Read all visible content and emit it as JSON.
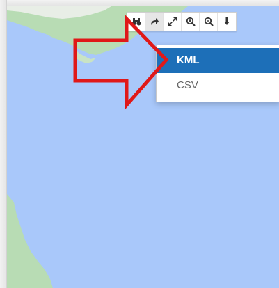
{
  "toolbar": {
    "buttons": [
      {
        "icon": "binoculars-icon",
        "active": false
      },
      {
        "icon": "share-arrow-icon",
        "active": true
      },
      {
        "icon": "expand-icon",
        "active": false
      },
      {
        "icon": "zoom-in-icon",
        "active": false
      },
      {
        "icon": "zoom-out-icon",
        "active": false
      },
      {
        "icon": "download-icon",
        "active": false
      }
    ]
  },
  "export_menu": {
    "items": [
      {
        "label": "KML",
        "selected": true
      },
      {
        "label": "CSV",
        "selected": false
      }
    ]
  },
  "colors": {
    "water": "#a9c8fa",
    "land": "#b8dcb4",
    "menu_selected": "#1d6fb8",
    "annotation_arrow": "#e01818"
  }
}
